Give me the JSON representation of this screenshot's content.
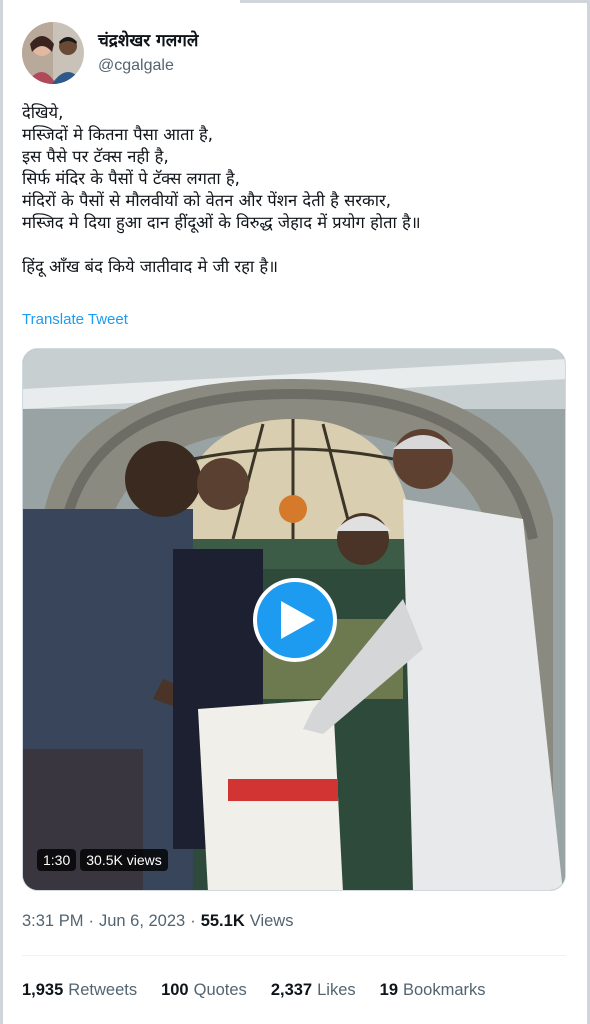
{
  "user": {
    "display_name": "चंद्रशेखर गलगले",
    "handle": "@cgalgale"
  },
  "tweet": {
    "lines": [
      "देखिये,",
      "मस्जिदों मे कितना पैसा आता है,",
      "इस पैसे पर टॅक्स नही है,",
      "सिर्फ मंदिर के पैसों पे टॅक्स लगता है,",
      "मंदिरों के पैसों से मौलवीयों को वेतन और पेंशन देती है सरकार,",
      "मस्जिद मे दिया हुआ दान हींदूओं के विरुद्ध जेहाद में प्रयोग होता है॥"
    ],
    "closing_line": "हिंदू आँख बंद किये जातीवाद मे जी रहा है॥",
    "translate_label": "Translate Tweet"
  },
  "video": {
    "duration": "1:30",
    "views": "30.5K views",
    "play_icon": "play-icon"
  },
  "meta": {
    "time": "3:31 PM",
    "separator": "·",
    "date": "Jun 6, 2023",
    "views_count": "55.1K",
    "views_label": "Views"
  },
  "stats": [
    {
      "count": "1,935",
      "label": "Retweets"
    },
    {
      "count": "100",
      "label": "Quotes"
    },
    {
      "count": "2,337",
      "label": "Likes"
    },
    {
      "count": "19",
      "label": "Bookmarks"
    }
  ],
  "colors": {
    "accent": "#1d9bf0",
    "text": "#0f1419",
    "muted": "#536471"
  }
}
